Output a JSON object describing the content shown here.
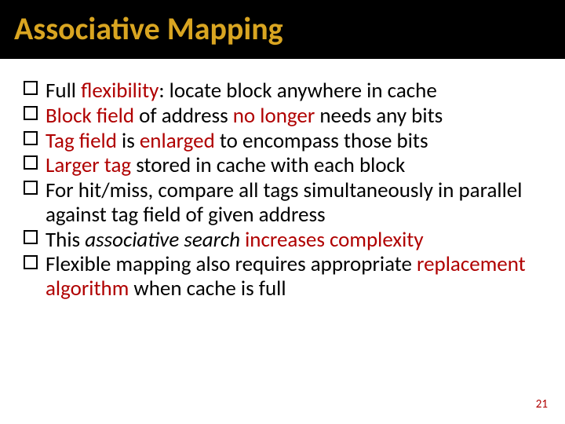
{
  "title": "Associative Mapping",
  "bullets": {
    "b1_a": "Full ",
    "b1_b": "flexibility",
    "b1_c": ": locate block anywhere in cache",
    "b2_a": "Block field",
    "b2_b": " of address ",
    "b2_c": "no longer",
    "b2_d": " needs any bits",
    "b3_a": "Tag field",
    "b3_b": " is ",
    "b3_c": "enlarged",
    "b3_d": " to encompass those bits",
    "b4_a": "Larger tag",
    "b4_b": " stored in cache with each block",
    "b5": "For hit/miss, compare all tags simultaneously in parallel against tag field of given address",
    "b6_a": "This ",
    "b6_b": "associative search",
    "b6_c": " increases complexity",
    "b7_a": "Flexible mapping also requires appropriate ",
    "b7_b": "replacement algorithm",
    "b7_c": " when cache is full"
  },
  "page_number": "21"
}
